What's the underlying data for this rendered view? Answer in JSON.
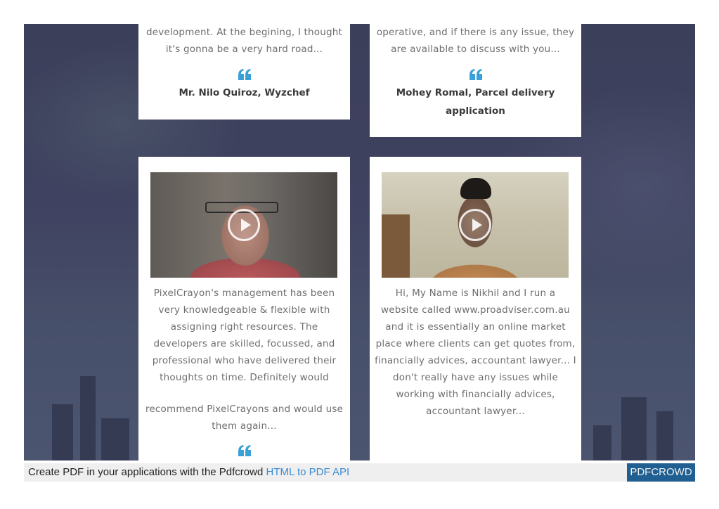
{
  "testimonials_top": [
    {
      "text_lines": [
        "development. At the begining, I thought",
        "it's gonna be a very hard road..."
      ],
      "author": "Mr. Nilo Quiroz, Wyzchef"
    },
    {
      "text_lines": [
        "operative, and if there is any issue, they",
        "are available to discuss with you..."
      ],
      "author_lines": [
        "Mohey Romal, Parcel delivery",
        "application"
      ]
    }
  ],
  "testimonials_bottom": [
    {
      "video_icon": "play-icon",
      "text_lines": [
        "PixelCrayon's management has been",
        "very knowledgeable & flexible with",
        "assigning right resources. The",
        "developers are skilled, focussed, and",
        "professional who have delivered their",
        "thoughts on time. Definitely would",
        "",
        "recommend PixelCrayons and would use",
        "them again..."
      ]
    },
    {
      "video_icon": "play-icon",
      "text_lines": [
        "Hi, My Name is Nikhil and I run a",
        "website called www.proadviser.com.au",
        "and it is essentially an online market",
        "place where clients can get quotes from,",
        "financially advices, accountant lawyer... I",
        "don't really have any issues while",
        "working with financially advices,",
        "accountant lawyer..."
      ]
    }
  ],
  "quote_icon": "quote-icon",
  "colors": {
    "accent": "#3aa0d8",
    "pdf_button": "#1f5f91"
  },
  "pdfbar": {
    "text": "Create PDF in your applications with the Pdfcrowd",
    "link": "HTML to PDF API",
    "button": "PDFCROWD"
  }
}
